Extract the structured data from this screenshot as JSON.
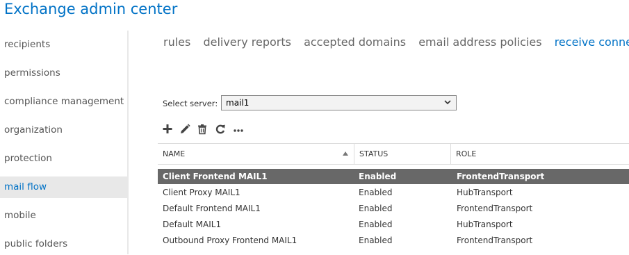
{
  "app": {
    "title": "Exchange admin center"
  },
  "sidebar": {
    "items": [
      {
        "label": "recipients"
      },
      {
        "label": "permissions"
      },
      {
        "label": "compliance management"
      },
      {
        "label": "organization"
      },
      {
        "label": "protection"
      },
      {
        "label": "mail flow",
        "active": true
      },
      {
        "label": "mobile"
      },
      {
        "label": "public folders"
      }
    ]
  },
  "tabs": [
    {
      "label": "rules"
    },
    {
      "label": "delivery reports"
    },
    {
      "label": "accepted domains"
    },
    {
      "label": "email address policies"
    },
    {
      "label": "receive connectors",
      "active": true
    }
  ],
  "server": {
    "label": "Select server:",
    "value": "mail1"
  },
  "toolbar": {
    "icons": [
      "add-icon",
      "edit-icon",
      "delete-icon",
      "refresh-icon",
      "more-icon"
    ]
  },
  "table": {
    "columns": [
      "NAME",
      "STATUS",
      "ROLE"
    ],
    "sort": {
      "column": "NAME",
      "direction": "ascending"
    },
    "rows": [
      {
        "name": "Client Frontend MAIL1",
        "status": "Enabled",
        "role": "FrontendTransport",
        "selected": true
      },
      {
        "name": "Client Proxy MAIL1",
        "status": "Enabled",
        "role": "HubTransport"
      },
      {
        "name": "Default Frontend MAIL1",
        "status": "Enabled",
        "role": "FrontendTransport"
      },
      {
        "name": "Default MAIL1",
        "status": "Enabled",
        "role": "HubTransport"
      },
      {
        "name": "Outbound Proxy Frontend MAIL1",
        "status": "Enabled",
        "role": "FrontendTransport"
      }
    ]
  },
  "colors": {
    "accent": "#0072c6",
    "selected_row": "#686868",
    "nav_active_bg": "#e8e8e8"
  }
}
